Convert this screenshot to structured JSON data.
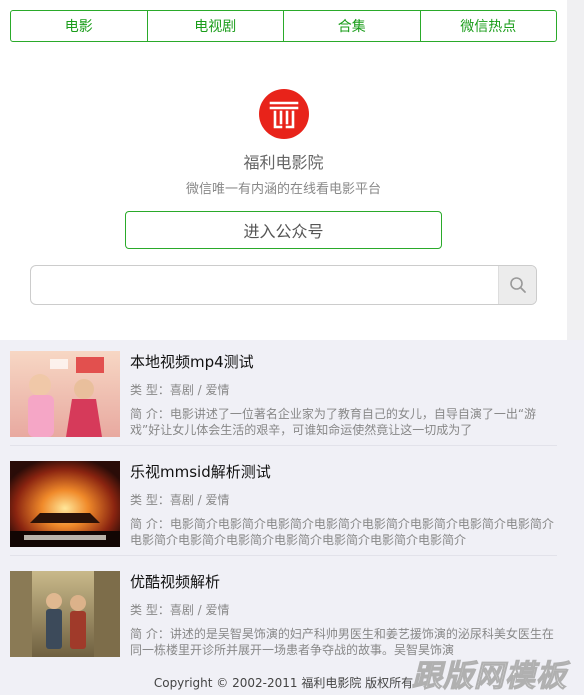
{
  "nav": {
    "tabs": [
      "电影",
      "电视剧",
      "合集",
      "微信热点"
    ]
  },
  "profile": {
    "logo_icon": "brand-logo-icon",
    "name": "福利电影院",
    "tagline": "微信唯一有内涵的在线看电影平台",
    "follow_label": "进入公众号"
  },
  "search": {
    "placeholder": "",
    "icon": "search-icon"
  },
  "videos": [
    {
      "title": "本地视频mp4测试",
      "genre": "类 型：喜剧 / 爱情",
      "desc": "简 介：电影讲述了一位著名企业家为了教育自己的女儿，自导自演了一出“游戏”好让女儿体会生活的艰辛，可谁知命运使然竟让这一切成为了"
    },
    {
      "title": "乐视mmsid解析测试",
      "genre": "类 型：喜剧 / 爱情",
      "desc": "简 介：电影简介电影简介电影简介电影简介电影简介电影简介电影简介电影简介电影简介电影简介电影简介电影简介电影简介电影简介电影简介"
    },
    {
      "title": "优酷视频解析",
      "genre": "类 型：喜剧 / 爱情",
      "desc": "简 介：讲述的是吴智昊饰演的妇产科帅男医生和姜艺援饰演的泌尿科美女医生在同一栋楼里开诊所并展开一场患者争夺战的故事。吴智昊饰演"
    }
  ],
  "footer": "Copyright © 2002-2011 福利电影院 版权所有",
  "watermark": "跟版网模板",
  "colors": {
    "accent": "#1a9d1a",
    "logo": "#e8231a",
    "list_bg": "#f0f0f6"
  }
}
